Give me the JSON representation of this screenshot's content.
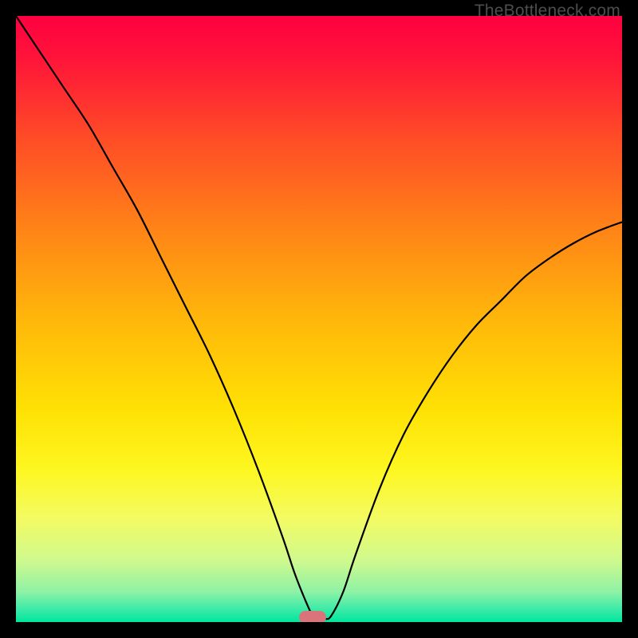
{
  "watermark": "TheBottleneck.com",
  "chart_data": {
    "type": "line",
    "title": "",
    "xlabel": "",
    "ylabel": "",
    "yunit": "percent",
    "xlim": [
      0,
      100
    ],
    "ylim": [
      0,
      100
    ],
    "grid": false,
    "legend": false,
    "background_gradient": {
      "direction": "vertical",
      "stops": [
        {
          "pos": 0.0,
          "color": "#ff0040"
        },
        {
          "pos": 0.07,
          "color": "#ff1439"
        },
        {
          "pos": 0.2,
          "color": "#ff4b27"
        },
        {
          "pos": 0.35,
          "color": "#ff8317"
        },
        {
          "pos": 0.5,
          "color": "#ffb70a"
        },
        {
          "pos": 0.65,
          "color": "#ffe104"
        },
        {
          "pos": 0.75,
          "color": "#fdf721"
        },
        {
          "pos": 0.83,
          "color": "#f3fb63"
        },
        {
          "pos": 0.9,
          "color": "#cef98f"
        },
        {
          "pos": 0.95,
          "color": "#8ef2a4"
        },
        {
          "pos": 0.975,
          "color": "#46eca8"
        },
        {
          "pos": 1.0,
          "color": "#00e69d"
        }
      ]
    },
    "series": [
      {
        "name": "bottleneck-curve",
        "stroke": "#000000",
        "stroke_width": 2.2,
        "x": [
          0,
          4,
          8,
          12,
          16,
          20,
          24,
          28,
          32,
          36,
          40,
          44,
          46,
          48,
          49,
          50,
          51,
          52,
          54,
          56,
          60,
          64,
          68,
          72,
          76,
          80,
          84,
          88,
          92,
          96,
          100
        ],
        "y": [
          100,
          94,
          88,
          82,
          75,
          68,
          60,
          52,
          44,
          35,
          25,
          14,
          8,
          3,
          1,
          0.5,
          0.5,
          1,
          5,
          11,
          22,
          31,
          38,
          44,
          49,
          53,
          57,
          60,
          62.5,
          64.5,
          66
        ]
      }
    ],
    "marker": {
      "name": "optimum-region",
      "shape": "pill",
      "color": "#d9757a",
      "x": 49,
      "y": 0
    }
  }
}
